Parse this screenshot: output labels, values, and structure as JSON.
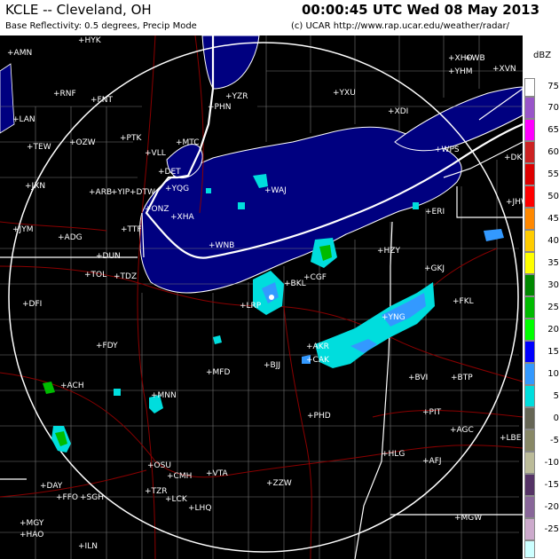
{
  "header": {
    "station": "KCLE -- Cleveland, OH",
    "product": "Base Reflectivity: 0.5 degrees, Precip Mode",
    "timestamp": "00:00:45 UTC Wed 08 May 2013",
    "credit": "(c) UCAR  http://www.rap.ucar.edu/weather/radar/"
  },
  "legend": {
    "unit": "dBZ",
    "levels": [
      {
        "value": "75",
        "color": "#ffffff"
      },
      {
        "value": "70",
        "color": "#9955c9"
      },
      {
        "value": "65",
        "color": "#ff00ff"
      },
      {
        "value": "60",
        "color": "#cc2222"
      },
      {
        "value": "55",
        "color": "#dd0000"
      },
      {
        "value": "50",
        "color": "#ff0000"
      },
      {
        "value": "45",
        "color": "#ff8800"
      },
      {
        "value": "40",
        "color": "#ffcc00"
      },
      {
        "value": "35",
        "color": "#ffff00"
      },
      {
        "value": "30",
        "color": "#008800"
      },
      {
        "value": "25",
        "color": "#00bb00"
      },
      {
        "value": "20",
        "color": "#00ff00"
      },
      {
        "value": "15",
        "color": "#0000ff"
      },
      {
        "value": "10",
        "color": "#3399ff"
      },
      {
        "value": "5",
        "color": "#00dddd"
      },
      {
        "value": "0",
        "color": "#666655"
      },
      {
        "value": "-5",
        "color": "#888866"
      },
      {
        "value": "-10",
        "color": "#bbbb99"
      },
      {
        "value": "-15",
        "color": "#553366"
      },
      {
        "value": "-20",
        "color": "#886699"
      },
      {
        "value": "-25",
        "color": "#ccaacc"
      },
      {
        "value": "",
        "color": "#ccffff"
      }
    ]
  },
  "colors": {
    "background": "#000000",
    "lake": "#000080",
    "county_lines": "#777777",
    "state_lines": "#ffffff",
    "roads": "#8b0000",
    "range_ring": "#ffffff"
  },
  "sites": [
    "HYK",
    "AMN",
    "RNF",
    "FNT",
    "LAN",
    "OZW",
    "PTK",
    "TEW",
    "VLL",
    "MTC",
    "DET",
    "YQG",
    "YIP",
    "DTW",
    "ARB",
    "JXN",
    "ONZ",
    "XHA",
    "TTF",
    "ADG",
    "JYM",
    "DUN",
    "TOL",
    "TDZ",
    "DFI",
    "YZR",
    "PHN",
    "YXU",
    "XDI",
    "XHO",
    "WB",
    "YHM",
    "XVN",
    "WPS",
    "DKK",
    "JHW",
    "WAJ",
    "ERI",
    "WNB",
    "HZY",
    "GKJ",
    "BKL",
    "CGF",
    "LRP",
    "FKL",
    "YNG",
    "AKR",
    "CAK",
    "FDY",
    "MFD",
    "BJJ",
    "BVI",
    "BTP",
    "PIT",
    "AGC",
    "LBE",
    "PHD",
    "HLG",
    "AFJ",
    "ACH",
    "MNN",
    "OSU",
    "CMH",
    "VTA",
    "TZR",
    "LCK",
    "ZZW",
    "LHQ",
    "DAY",
    "FFO",
    "SGH",
    "MGY",
    "HAO",
    "ILN",
    "MGW"
  ]
}
